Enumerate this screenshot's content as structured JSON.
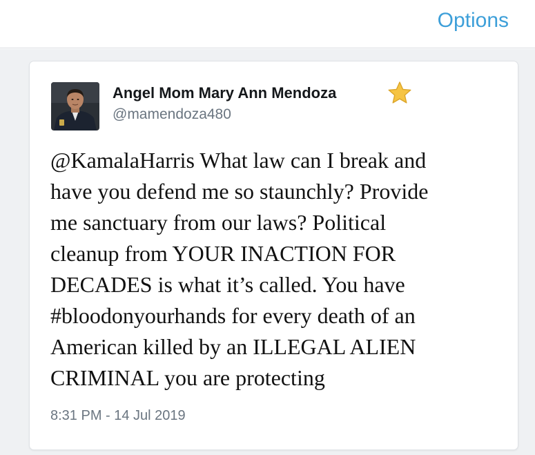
{
  "header": {
    "options_label": "Options"
  },
  "tweet": {
    "author_name": "Angel Mom Mary Ann Mendoza",
    "author_handle": "@mamendoza480",
    "text_lines": [
      "@KamalaHarris What law can I break and",
      "have you defend me so staunchly? Provide",
      "me sanctuary from our laws? Political",
      "cleanup from YOUR INACTION FOR",
      "DECADES is what it’s called. You have",
      "#bloodonyourhands for every death of an",
      "American killed by an ILLEGAL ALIEN",
      "CRIMINAL you are protecting"
    ],
    "timestamp": "8:31 PM - 14 Jul 2019"
  },
  "icons": {
    "name_badge": "star-emoji-icon",
    "avatar": "profile-photo"
  },
  "colors": {
    "link_blue": "#3d9fd9",
    "page_gray": "#eff1f3",
    "secondary_text": "#6a7580",
    "primary_text": "#14171a",
    "star": "#f6c443"
  }
}
